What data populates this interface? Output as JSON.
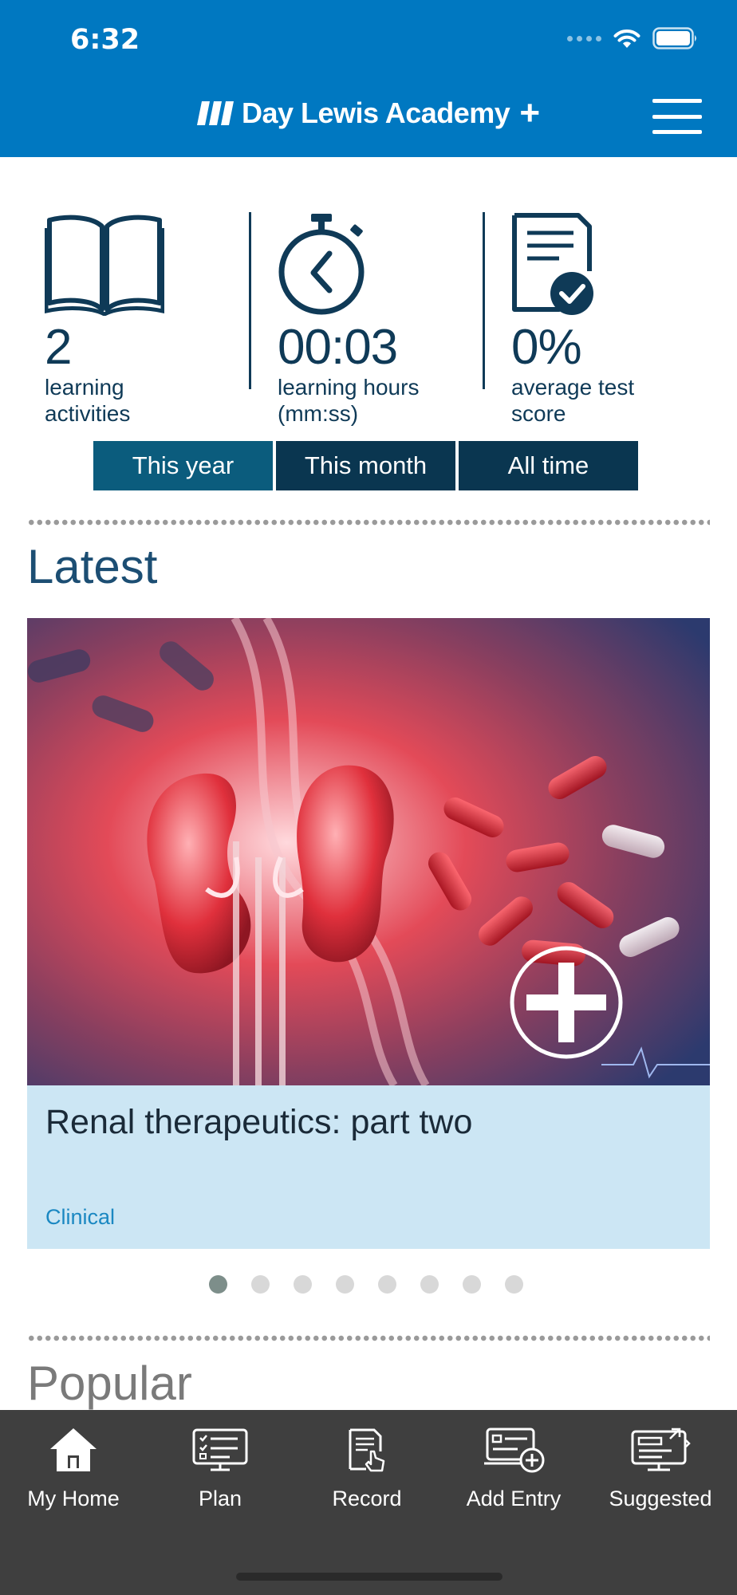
{
  "status_bar": {
    "time": "6:32"
  },
  "header": {
    "brand": "Day Lewis Academy",
    "brand_plus": "+",
    "menu_icon": "hamburger-icon"
  },
  "stats": [
    {
      "icon": "book-icon",
      "value": "2",
      "label_line1": "learning",
      "label_line2": "activities"
    },
    {
      "icon": "stopwatch-icon",
      "value": "00:03",
      "label_line1": "learning hours",
      "label_line2": "(mm:ss)"
    },
    {
      "icon": "test-score-icon",
      "value": "0%",
      "label_line1": "average test",
      "label_line2": "score"
    }
  ],
  "range_tabs": [
    {
      "label": "This year",
      "active": true
    },
    {
      "label": "This month",
      "active": false
    },
    {
      "label": "All time",
      "active": false
    }
  ],
  "latest": {
    "title": "Latest",
    "card": {
      "title": "Renal therapeutics: part two",
      "category": "Clinical"
    },
    "carousel": {
      "count": 8,
      "active_index": 1
    }
  },
  "popular": {
    "title": "Popular"
  },
  "tabbar": [
    {
      "label": "My Home",
      "icon": "home-icon"
    },
    {
      "label": "Plan",
      "icon": "plan-icon"
    },
    {
      "label": "Record",
      "icon": "record-icon"
    },
    {
      "label": "Add Entry",
      "icon": "add-entry-icon"
    },
    {
      "label": "Suggested",
      "icon": "suggested-icon"
    }
  ],
  "colors": {
    "header": "#0078c1",
    "navy": "#0f3a57",
    "tab_active": "#0b5c7d",
    "tab_inactive": "#0a3650",
    "card_body": "#cce6f4",
    "category": "#1b88c2",
    "tabbar": "#3f3f3f"
  }
}
